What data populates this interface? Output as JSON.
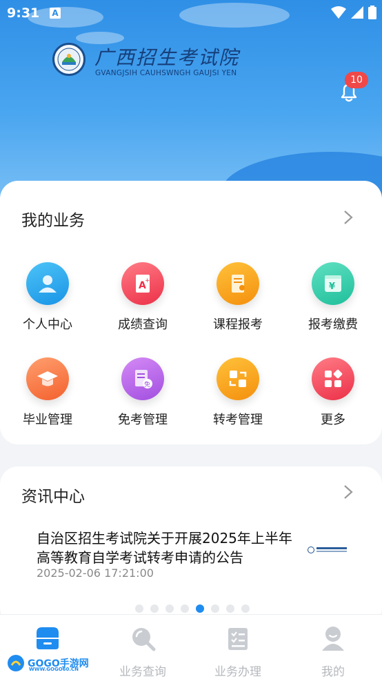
{
  "status_bar": {
    "time": "9:31",
    "notification_icon": "A"
  },
  "header": {
    "title": "广西招生考试院",
    "subtitle": "GVANGJSIH CAUHSWNGH GAUJSI YEN",
    "notification_count": "10"
  },
  "business": {
    "title": "我的业务",
    "items": [
      {
        "label": "个人中心",
        "icon": "person-icon",
        "color": "#23a6ec"
      },
      {
        "label": "成绩查询",
        "icon": "grade-icon",
        "color": "#f0465a"
      },
      {
        "label": "课程报考",
        "icon": "course-icon",
        "color": "#f7a21a"
      },
      {
        "label": "报考缴费",
        "icon": "yen-payment-icon",
        "color": "#2fc9a6"
      },
      {
        "label": "毕业管理",
        "icon": "graduation-cap-icon",
        "color": "#f57b45"
      },
      {
        "label": "免考管理",
        "icon": "exempt-icon",
        "color": "#b665e6"
      },
      {
        "label": "转考管理",
        "icon": "transfer-icon",
        "color": "#f7a21a"
      },
      {
        "label": "更多",
        "icon": "more-grid-icon",
        "color": "#f0465a"
      }
    ]
  },
  "news": {
    "title": "资讯中心",
    "headline": "自治区招生考试院关于开展2025年上半年高等教育自学考试转考申请的公告",
    "date": "2025-02-06 17:21:00",
    "carousel": {
      "count": 8,
      "active": 5
    }
  },
  "tabbar": {
    "items": [
      {
        "label": "",
        "icon": "home-icon",
        "active": true
      },
      {
        "label": "业务查询",
        "icon": "search-icon",
        "active": false
      },
      {
        "label": "业务办理",
        "icon": "clipboard-icon",
        "active": false
      },
      {
        "label": "我的",
        "icon": "profile-icon",
        "active": false
      }
    ]
  },
  "watermark": {
    "text": "GOGO手游网",
    "sub": "WWW.GOGO60.CN"
  },
  "colors": {
    "accent": "#1f8cf0",
    "header_blue": "#2f8fe6",
    "badge_red": "#f04848"
  }
}
